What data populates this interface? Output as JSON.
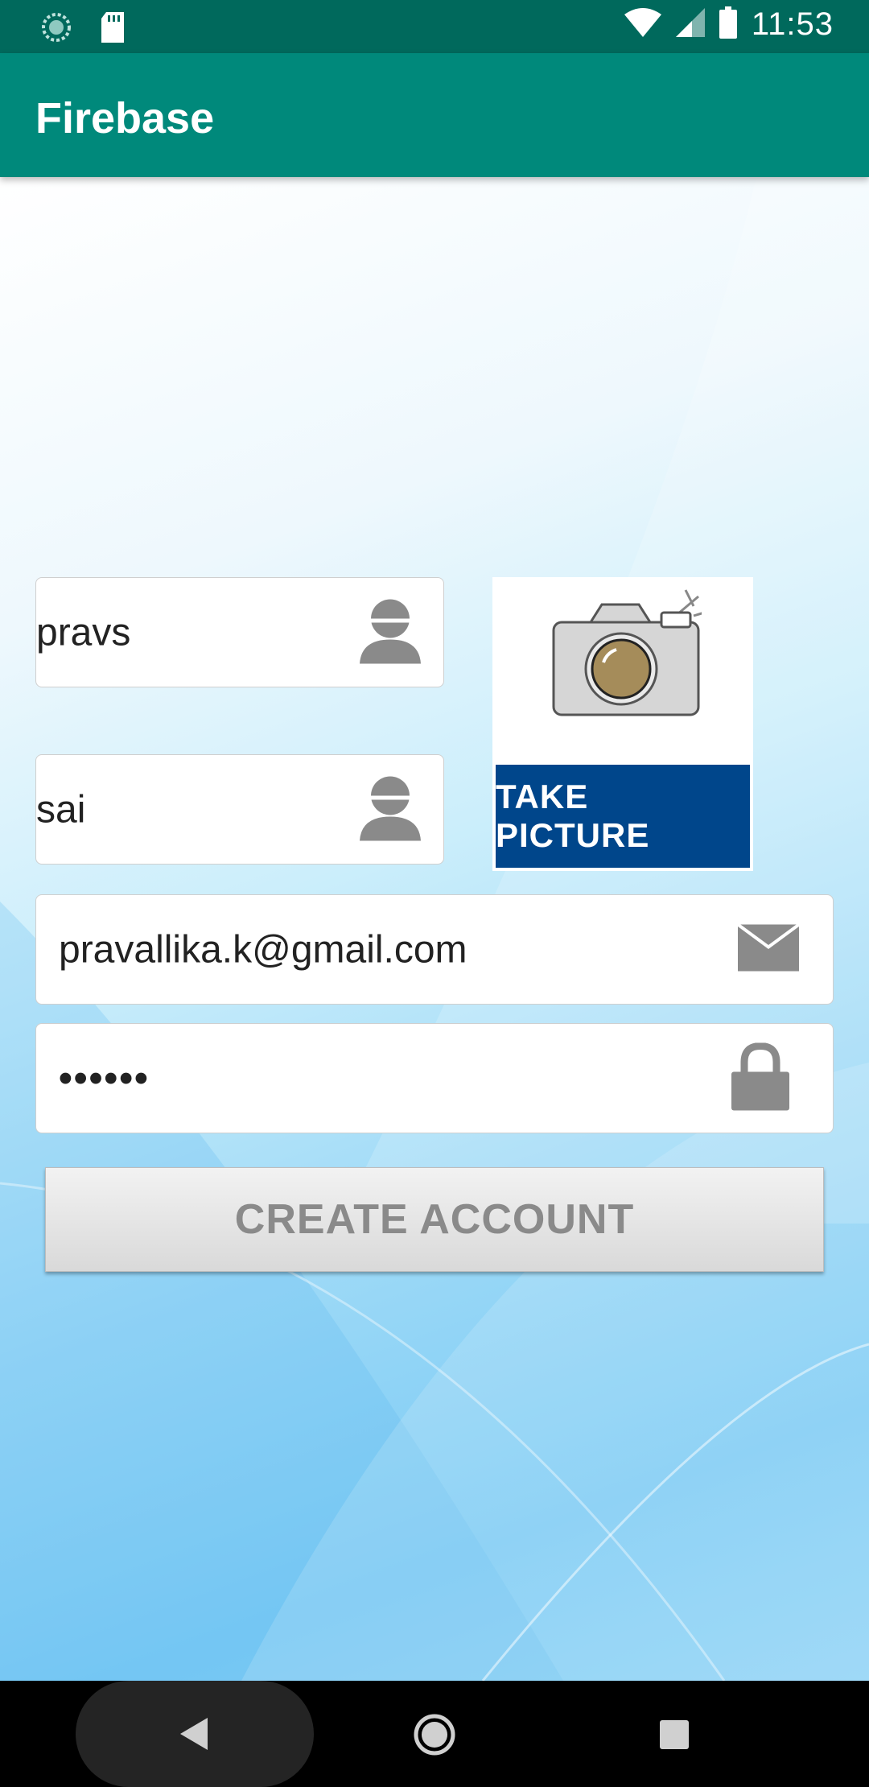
{
  "status_bar": {
    "time": "11:53",
    "icons": [
      "sync-icon",
      "sd-card-icon",
      "wifi-icon",
      "signal-icon",
      "battery-icon"
    ]
  },
  "app_bar": {
    "title": "Firebase"
  },
  "form": {
    "first_name": {
      "value": "pravs",
      "icon": "person-icon"
    },
    "last_name": {
      "value": "sai",
      "icon": "person-icon"
    },
    "email": {
      "value": "pravallika.k@gmail.com",
      "icon": "envelope-icon"
    },
    "password": {
      "value": "••••••",
      "icon": "lock-icon"
    },
    "take_picture_label": "TAKE PICTURE",
    "create_account_label": "CREATE ACCOUNT"
  },
  "nav_bar": {
    "icons": [
      "back-icon",
      "home-icon",
      "recents-icon"
    ]
  },
  "colors": {
    "status_bar": "#00695c",
    "app_bar": "#00897b",
    "take_picture_bg": "#00468b"
  }
}
